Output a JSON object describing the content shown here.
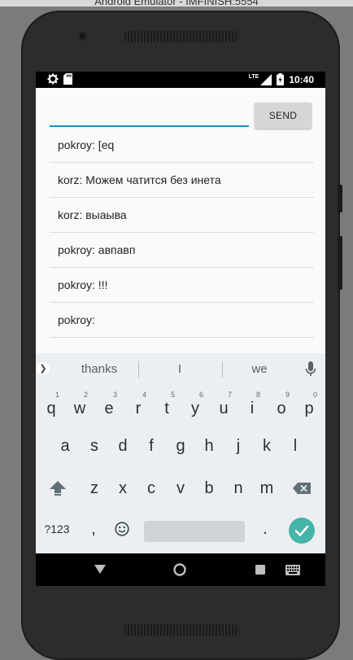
{
  "window": {
    "title": "Android Emulator - IMFINISH:5554"
  },
  "statusbar": {
    "time": "10:40",
    "network": "LTE"
  },
  "composer": {
    "input_value": "",
    "send_label": "SEND"
  },
  "messages": [
    {
      "text": "pokroy: [eq"
    },
    {
      "text": "korz: Можем чатится без инета"
    },
    {
      "text": "korz: выаыва"
    },
    {
      "text": "pokroy: авпавп"
    },
    {
      "text": "pokroy: !!!"
    },
    {
      "text": "pokroy:"
    }
  ],
  "keyboard": {
    "suggestions": [
      "thanks",
      "I",
      "we"
    ],
    "row1": [
      "q",
      "w",
      "e",
      "r",
      "t",
      "y",
      "u",
      "i",
      "o",
      "p"
    ],
    "row1_hints": [
      "1",
      "2",
      "3",
      "4",
      "5",
      "6",
      "7",
      "8",
      "9",
      "0"
    ],
    "row2": [
      "a",
      "s",
      "d",
      "f",
      "g",
      "h",
      "j",
      "k",
      "l"
    ],
    "row3": [
      "z",
      "x",
      "c",
      "v",
      "b",
      "n",
      "m"
    ],
    "symbols_label": "?123",
    "comma": ",",
    "period": "."
  },
  "colors": {
    "accent": "#1a8fb8",
    "enter": "#46b4a9",
    "keyboard_bg": "#eceff1"
  },
  "icons": [
    "gear-icon",
    "sd-card-icon",
    "lte-icon",
    "signal-icon",
    "battery-icon",
    "mic-icon",
    "shift-icon",
    "backspace-icon",
    "emoji-icon",
    "check-icon",
    "back-icon",
    "home-icon",
    "recents-icon",
    "keyboard-icon"
  ]
}
